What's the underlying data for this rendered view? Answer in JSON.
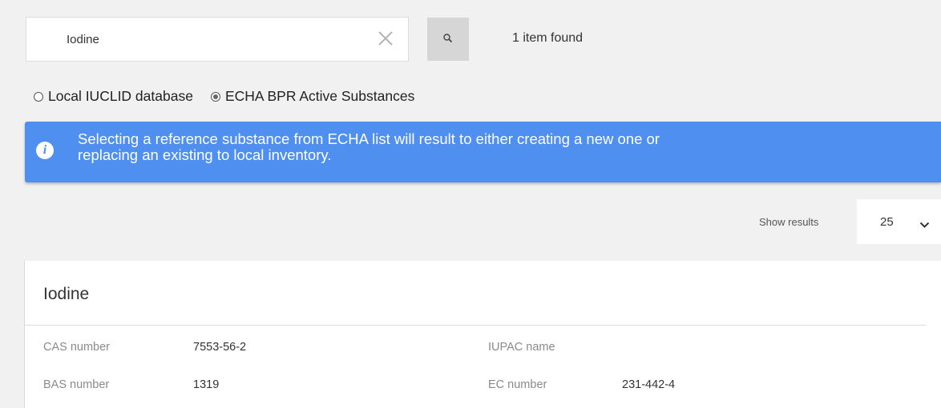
{
  "search": {
    "value": "Iodine",
    "result_count": "1 item found"
  },
  "sources": [
    {
      "label": "Local IUCLID database",
      "selected": false
    },
    {
      "label": "ECHA BPR Active Substances",
      "selected": true
    }
  ],
  "info_banner": {
    "line1": "Selecting a reference substance from ECHA list will result to either creating a new one or",
    "line2": "replacing an existing to local inventory.",
    "color": "#4f8ff0"
  },
  "pagination": {
    "label": "Show results",
    "page_size": "25"
  },
  "result": {
    "name": "Iodine",
    "fields": {
      "cas": {
        "label": "CAS number",
        "value": "7553-56-2"
      },
      "bas": {
        "label": "BAS number",
        "value": "1319"
      },
      "iupac": {
        "label": "IUPAC name",
        "value": ""
      },
      "ec": {
        "label": "EC number",
        "value": "231-442-4"
      }
    }
  },
  "icons": {
    "clear": "close-icon",
    "search": "search-icon",
    "info": "info-icon",
    "dropdown": "chevron-down-icon"
  }
}
